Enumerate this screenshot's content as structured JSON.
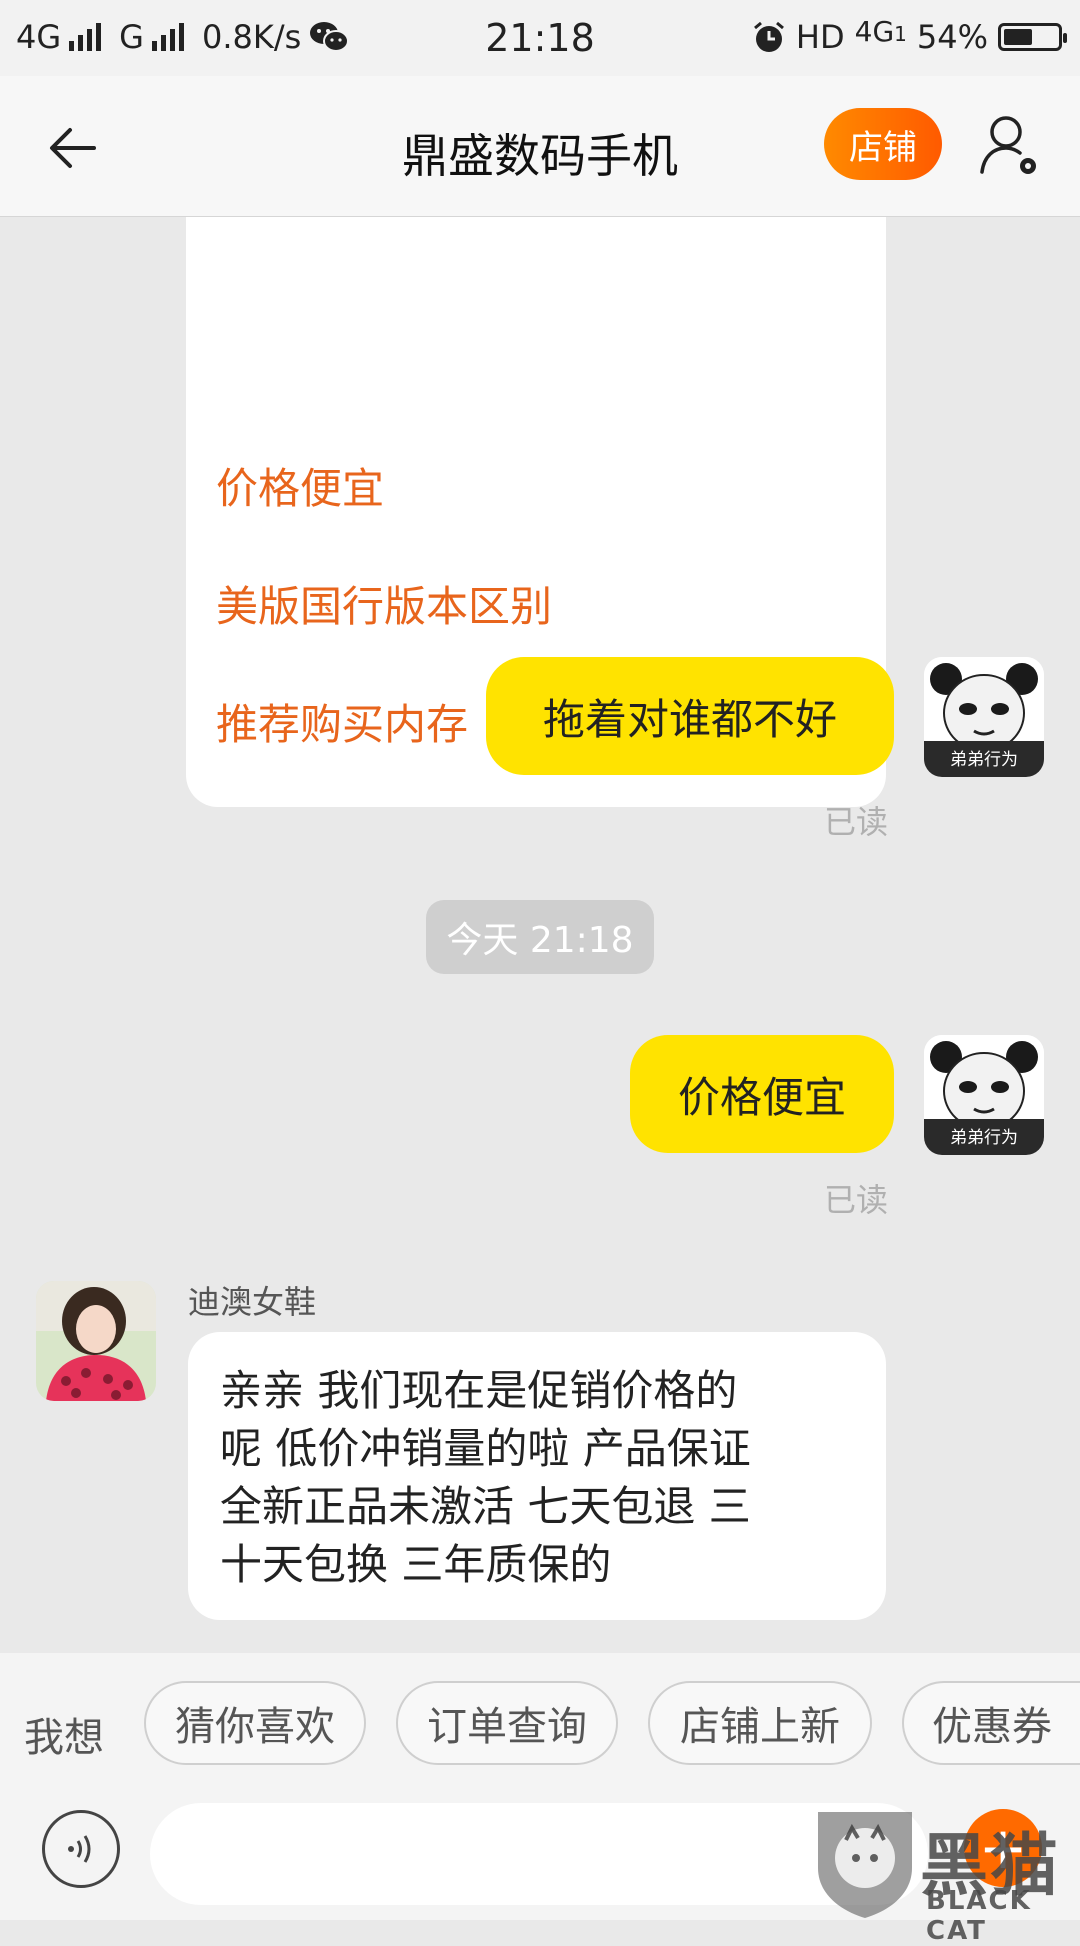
{
  "status_bar": {
    "network1": "4G",
    "network2": "G",
    "speed": "0.8K/s",
    "time": "21:18",
    "hd_label": "HD",
    "net_right": "4G",
    "net_right_sub": "1",
    "battery_pct": "54%",
    "battery_level": 0.54
  },
  "header": {
    "title": "鼎盛数码手机",
    "shop_button": "店铺"
  },
  "chat": {
    "quick_questions": [
      "价格便宜",
      "美版国行版本区别",
      "推荐购买内存"
    ],
    "messages": [
      {
        "text": "拖着对谁都不好",
        "status": "已读"
      },
      {
        "text": "价格便宜",
        "status": "已读"
      }
    ],
    "time_divider": "今天  21:18",
    "panda_caption": "弟弟行为",
    "seller_name": "迪澳女鞋",
    "seller_message_lines": [
      "亲亲 我们现在是促销价格的",
      "呢 低价冲销量的啦  产品保证",
      "全新正品未激活 七天包退 三",
      "十天包换 三年质保的"
    ]
  },
  "quick_bar": {
    "label": "我想",
    "chips": [
      "猜你喜欢",
      "订单查询",
      "店铺上新",
      "优惠券"
    ]
  },
  "watermark": {
    "text_cn": "黑猫",
    "text_en": "BLACK CAT"
  },
  "colors": {
    "accent_orange": "#ff6a00",
    "bubble_yellow": "#ffe300",
    "link_orange": "#e8651c"
  }
}
